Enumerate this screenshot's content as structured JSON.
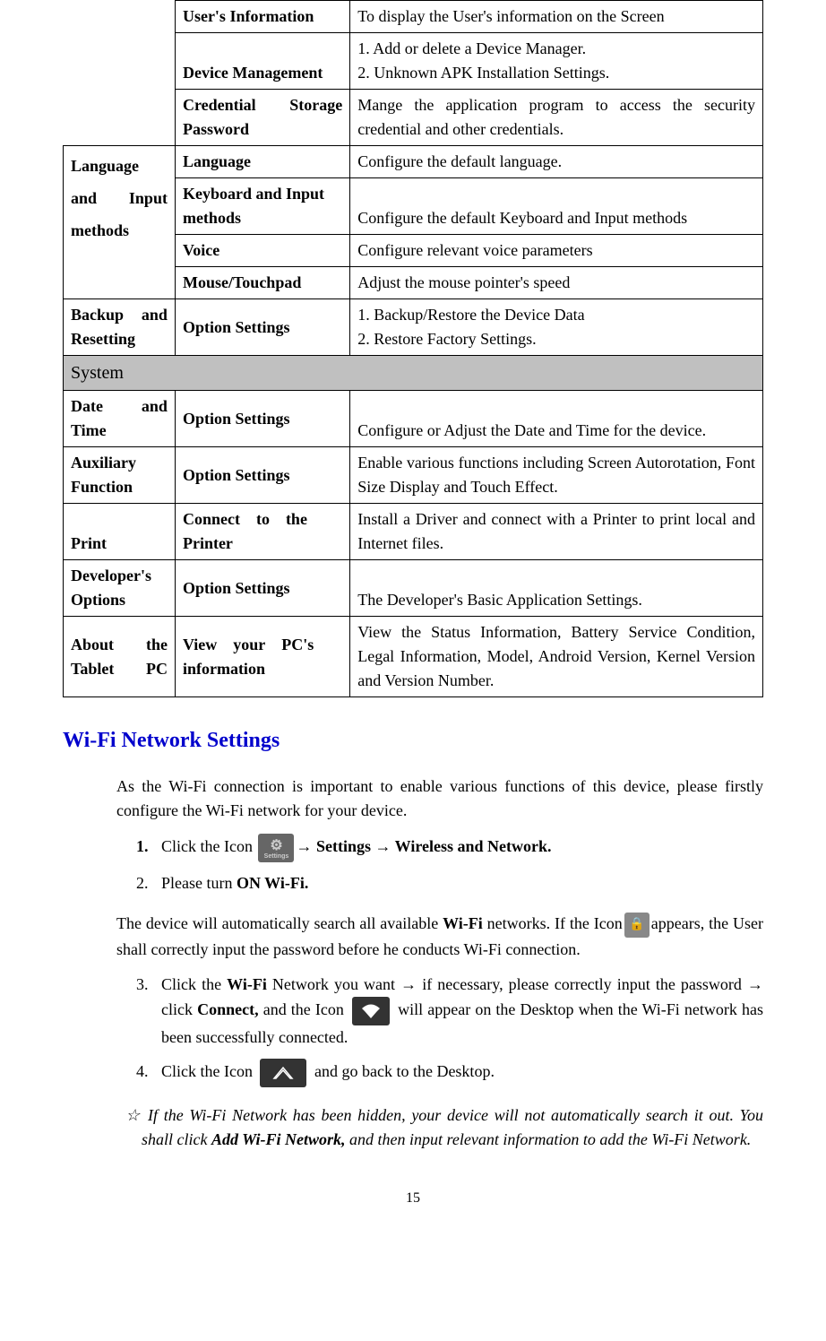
{
  "table": {
    "rows": [
      {
        "item": "User's Information",
        "desc": "To display the User's information on the Screen"
      },
      {
        "item": "Device Management",
        "desc": "1. Add or delete a Device Manager.\n2. Unknown APK Installation Settings."
      },
      {
        "item": "Credential Storage Password",
        "desc": "Mange the application program to access the security credential and other credentials."
      }
    ],
    "lang_category": "Language and Input methods",
    "lang_rows": [
      {
        "item": "Language",
        "desc": "Configure the default language."
      },
      {
        "item": "Keyboard and Input methods",
        "desc": "Configure the default Keyboard and Input methods"
      },
      {
        "item": "Voice",
        "desc": "Configure relevant voice parameters"
      },
      {
        "item": "Mouse/Touchpad",
        "desc": "Adjust the mouse pointer's speed"
      }
    ],
    "backup": {
      "cat": "Backup and Resetting",
      "item": "Option Settings",
      "desc": "1. Backup/Restore the Device Data\n2. Restore Factory Settings."
    },
    "section": "System",
    "system_rows": [
      {
        "cat": "Date and Time",
        "item": "Option Settings",
        "desc": "Configure or Adjust the Date and Time for the device."
      },
      {
        "cat": "Auxiliary Function",
        "item": "Option Settings",
        "desc": "Enable various functions including Screen Autorotation, Font Size Display and Touch Effect."
      },
      {
        "cat": "Print",
        "item": "Connect to the Printer",
        "desc": "Install a Driver and connect with a Printer to print local and Internet files."
      },
      {
        "cat": "Developer's Options",
        "item": "Option Settings",
        "desc": "The Developer's Basic Application Settings."
      },
      {
        "cat": "About the Tablet PC",
        "item": "View your PC's information",
        "desc": "View the Status Information, Battery Service Condition, Legal Information, Model, Android Version, Kernel Version and Version Number."
      }
    ]
  },
  "wifi": {
    "heading": "Wi-Fi Network Settings",
    "intro": "As the Wi-Fi connection is important to enable various functions of this device, please firstly configure the Wi-Fi network for your device.",
    "step1_a": "Click the Icon ",
    "step1_b": "→ Settings → Wireless and Network.",
    "step2_a": "Please turn ",
    "step2_b": "ON Wi-Fi.",
    "para2_a": "The device will automatically search all available ",
    "para2_b": "Wi-Fi",
    "para2_c": " networks. If the Icon",
    "para2_d": "appears, the User shall correctly input the password before he conducts Wi-Fi connection.",
    "step3_a": "Click the ",
    "step3_b": "Wi-Fi",
    "step3_c": " Network you want → if necessary, please correctly input the password → click ",
    "step3_d": "Connect,",
    "step3_e": " and the Icon ",
    "step3_f": " will appear on the Desktop when the Wi-Fi network has been successfully connected.",
    "step4_a": "Click the Icon ",
    "step4_b": " and go back to the Desktop.",
    "note_a": "☆ If the Wi-Fi Network has been hidden, your device will not automatically search it out. You shall click ",
    "note_b": "Add Wi-Fi Network,",
    "note_c": " and then input relevant information to add the Wi-Fi Network."
  },
  "page_number": "15"
}
